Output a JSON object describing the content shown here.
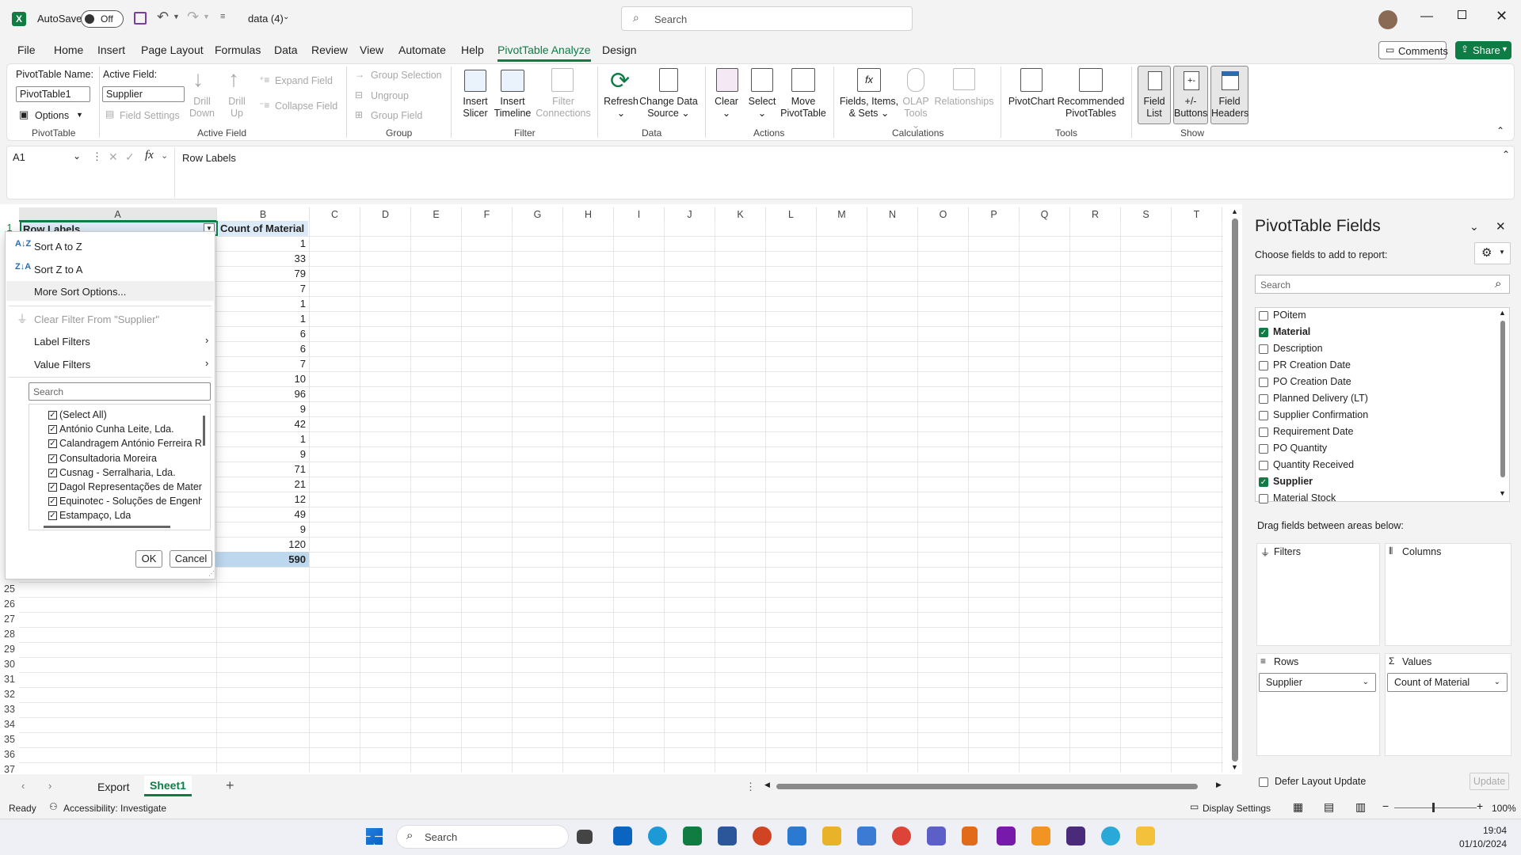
{
  "titlebar": {
    "autosave_label": "AutoSave",
    "autosave_state": "Off",
    "filename": "data (4)",
    "search_placeholder": "Search"
  },
  "menu": {
    "items": [
      "File",
      "Home",
      "Insert",
      "Page Layout",
      "Formulas",
      "Data",
      "Review",
      "View",
      "Automate",
      "Help",
      "PivotTable Analyze",
      "Design"
    ],
    "active": "PivotTable Analyze",
    "comments": "Comments",
    "share": "Share"
  },
  "ribbon": {
    "pivot_name_label": "PivotTable Name:",
    "pivot_name_value": "PivotTable1",
    "options": "Options",
    "group_pivottable": "PivotTable",
    "active_field_label": "Active Field:",
    "active_field_value": "Supplier",
    "field_settings": "Field Settings",
    "drill_down": "Drill Down",
    "drill_down_l1": "Drill",
    "drill_down_l2": "Down",
    "drill_up_l1": "Drill",
    "drill_up_l2": "Up",
    "expand_field": "Expand Field",
    "collapse_field": "Collapse Field",
    "group_active_field": "Active Field",
    "group_selection": "Group Selection",
    "ungroup": "Ungroup",
    "group_field": "Group Field",
    "group_group": "Group",
    "insert_slicer_l1": "Insert",
    "insert_slicer_l2": "Slicer",
    "insert_timeline_l1": "Insert",
    "insert_timeline_l2": "Timeline",
    "filter_connections_l1": "Filter",
    "filter_connections_l2": "Connections",
    "group_filter": "Filter",
    "refresh": "Refresh",
    "change_source_l1": "Change Data",
    "change_source_l2": "Source",
    "group_data": "Data",
    "clear": "Clear",
    "select": "Select",
    "move_l1": "Move",
    "move_l2": "PivotTable",
    "group_actions": "Actions",
    "fields_items_l1": "Fields, Items,",
    "fields_items_l2": "& Sets",
    "olap_l1": "OLAP",
    "olap_l2": "Tools",
    "relationships": "Relationships",
    "group_calculations": "Calculations",
    "pivotchart": "PivotChart",
    "recommended_l1": "Recommended",
    "recommended_l2": "PivotTables",
    "group_tools": "Tools",
    "field_list_l1": "Field",
    "field_list_l2": "List",
    "buttons_l1": "+/-",
    "buttons_l2": "Buttons",
    "field_headers_l1": "Field",
    "field_headers_l2": "Headers",
    "group_show": "Show"
  },
  "formula": {
    "namebox": "A1",
    "content": "Row Labels"
  },
  "grid": {
    "columns": [
      "A",
      "B",
      "C",
      "D",
      "E",
      "F",
      "G",
      "H",
      "I",
      "J",
      "K",
      "L",
      "M",
      "N",
      "O",
      "P",
      "Q",
      "R",
      "S",
      "T"
    ],
    "header_a": "Row Labels",
    "header_b": "Count of Material",
    "values": [
      "1",
      "33",
      "79",
      "7",
      "1",
      "1",
      "6",
      "6",
      "7",
      "10",
      "96",
      "9",
      "42",
      "1",
      "9",
      "71",
      "21",
      "12",
      "49",
      "9",
      "120"
    ],
    "grand_total": "590",
    "row_numbers_after": [
      "25",
      "26",
      "27",
      "28",
      "29",
      "30",
      "31",
      "32",
      "33",
      "34",
      "35",
      "36",
      "37"
    ],
    "row_one": "1"
  },
  "dropdown": {
    "sort_az": "Sort A to Z",
    "sort_za": "Sort Z to A",
    "more_sort": "More Sort Options...",
    "clear_filter": "Clear Filter From \"Supplier\"",
    "label_filters": "Label Filters",
    "value_filters": "Value Filters",
    "search_placeholder": "Search",
    "items": [
      "(Select All)",
      "António Cunha Leite, Lda.",
      "Calandragem António Ferreira Ril",
      "Consultadoria Moreira",
      "Cusnag - Serralharia, Lda.",
      "Dagol Representações de Materia",
      "Equinotec - Soluções de Engenha",
      "Estampaço, Lda"
    ],
    "ok": "OK",
    "cancel": "Cancel"
  },
  "pivot_pane": {
    "title": "PivotTable Fields",
    "subtitle": "Choose fields to add to report:",
    "search_placeholder": "Search",
    "fields": [
      {
        "name": "POitem",
        "checked": false
      },
      {
        "name": "Material",
        "checked": true
      },
      {
        "name": "Description",
        "checked": false
      },
      {
        "name": "PR Creation Date",
        "checked": false
      },
      {
        "name": "PO Creation Date",
        "checked": false
      },
      {
        "name": "Planned Delivery (LT)",
        "checked": false
      },
      {
        "name": "Supplier Confirmation",
        "checked": false
      },
      {
        "name": "Requirement Date",
        "checked": false
      },
      {
        "name": "PO Quantity",
        "checked": false
      },
      {
        "name": "Quantity Received",
        "checked": false
      },
      {
        "name": "Supplier",
        "checked": true
      },
      {
        "name": "Material Stock",
        "checked": false
      }
    ],
    "drag_label": "Drag fields between areas below:",
    "filters": "Filters",
    "columns": "Columns",
    "rows": "Rows",
    "values": "Values",
    "rows_field": "Supplier",
    "values_field": "Count of Material",
    "defer": "Defer Layout Update",
    "update": "Update"
  },
  "sheets": {
    "tabs": [
      "Export",
      "Sheet1"
    ],
    "active": "Sheet1"
  },
  "status": {
    "ready": "Ready",
    "accessibility": "Accessibility: Investigate",
    "display_settings": "Display Settings",
    "zoom": "100%"
  },
  "taskbar": {
    "search": "Search",
    "time": "19:04",
    "date": "01/10/2024"
  },
  "colors": {
    "excel_green": "#0f7b45",
    "pivot_header_blue": "#dce9f7",
    "grand_total_blue": "#bdd7ee"
  }
}
